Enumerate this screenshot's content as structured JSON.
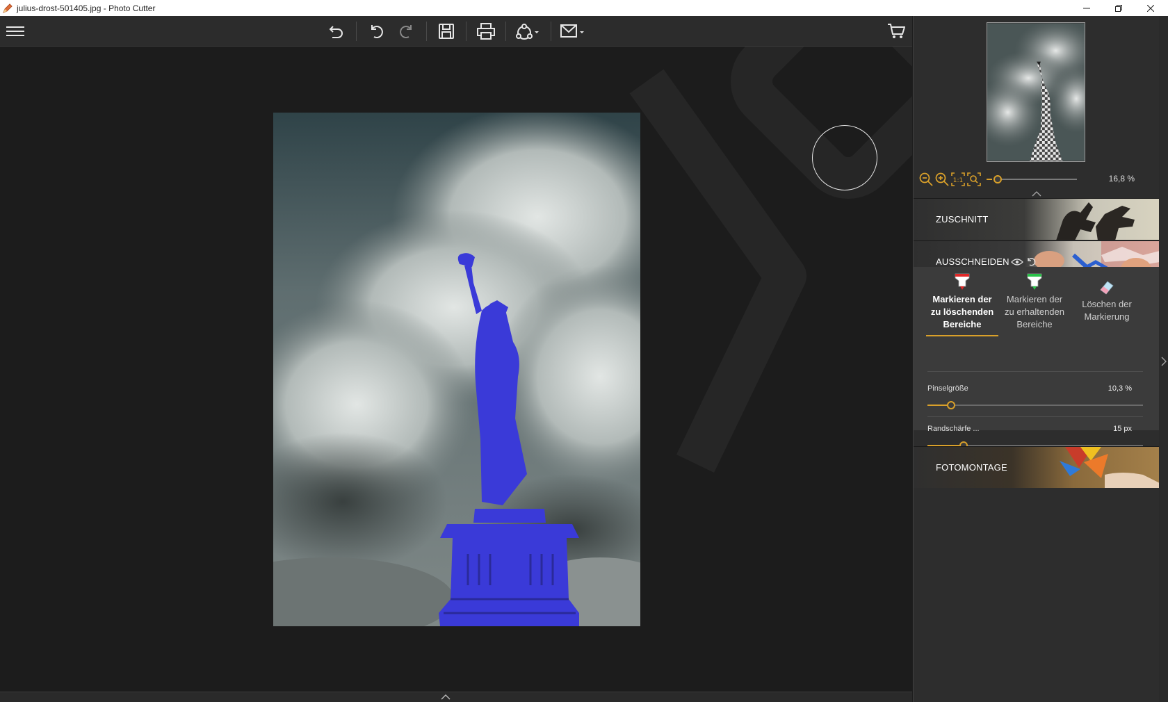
{
  "window": {
    "title": "julius-drost-501405.jpg - Photo Cutter",
    "controls": [
      "minimize-icon",
      "restore-icon",
      "close-icon"
    ]
  },
  "toolbar": {
    "buttons": [
      "menu-icon",
      "undo-all-icon",
      "undo-icon",
      "redo-icon",
      "save-icon",
      "print-icon",
      "share-icon",
      "email-icon",
      "cart-icon"
    ]
  },
  "navigator": {
    "zoom_value": "16,8 %",
    "zoom_level": 0.05
  },
  "sections": {
    "crop": {
      "label": "ZUSCHNITT",
      "expanded": false
    },
    "cutout": {
      "label": "AUSSCHNEIDEN",
      "expanded": true
    },
    "montage": {
      "label": "FOTOMONTAGE",
      "expanded": false
    }
  },
  "cutout": {
    "tools": [
      {
        "label": "Markieren der zu löschenden Bereiche",
        "lines": [
          "Markieren der",
          "zu löschenden",
          "Bereiche"
        ],
        "icon": "red-marker-icon",
        "active": true
      },
      {
        "label": "Markieren der zu erhaltenden Bereiche",
        "lines": [
          "Markieren der",
          "zu erhaltenden",
          "Bereiche"
        ],
        "icon": "green-marker-icon",
        "active": false
      },
      {
        "label": "Löschen der Markierung",
        "lines": [
          "Löschen der",
          "Markierung"
        ],
        "icon": "eraser-icon",
        "active": false
      }
    ],
    "brush_size": {
      "label": "Pinselgröße",
      "value": "10,3 %",
      "level": 0.11
    },
    "edge_softness": {
      "label": "Randschärfe ...",
      "value": "15 px",
      "level": 0.17
    }
  },
  "colors": {
    "accent": "#d9a02a",
    "mask": "#3a3ad8",
    "background": "#1c1c1c"
  }
}
